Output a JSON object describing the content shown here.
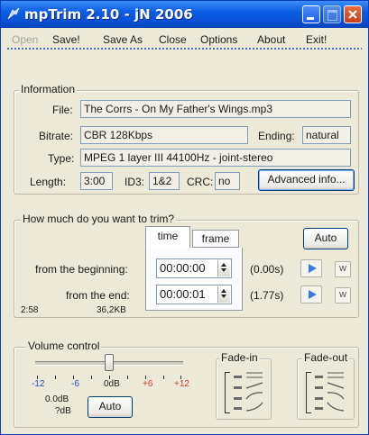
{
  "window": {
    "title": "mpTrim 2.10 - jN 2006"
  },
  "menu": {
    "items": [
      "Open",
      "Save!",
      "Save As",
      "Close",
      "Options",
      "About",
      "Exit!"
    ],
    "disabled": [
      "Open"
    ]
  },
  "information": {
    "group_title": "Information",
    "file_label": "File:",
    "file_value": "The Corrs - On My Father's Wings.mp3",
    "bitrate_label": "Bitrate:",
    "bitrate_value": "CBR 128Kbps",
    "ending_label": "Ending:",
    "ending_value": "natural",
    "type_label": "Type:",
    "type_value": "MPEG 1 layer III 44100Hz - joint-stereo",
    "length_label": "Length:",
    "length_value": "3:00",
    "id3_label": "ID3:",
    "id3_value": "1&2",
    "crc_label": "CRC:",
    "crc_value": "no",
    "advanced_button": "Advanced info..."
  },
  "trim": {
    "group_title": "How much do you want to trim?",
    "tab_time": "time",
    "tab_frame": "frame",
    "auto_button": "Auto",
    "beginning_label": "from the beginning:",
    "beginning_value": "00:00:00",
    "beginning_seconds": "(0.00s)",
    "end_label": "from the end:",
    "end_value": "00:00:01",
    "end_seconds": "(1.77s)",
    "w_label": "w",
    "duration": "2:58",
    "size": "36,2KB"
  },
  "volume": {
    "group_title": "Volume control",
    "scale": [
      "-12",
      "-6",
      "0dB",
      "+6",
      "+12"
    ],
    "level_fraction": 0.5,
    "gain_db": "0.0dB",
    "peak": "?dB",
    "auto_button": "Auto",
    "fade_in_label": "Fade-in",
    "fade_out_label": "Fade-out"
  },
  "colors": {
    "titlebar": "#0a5ee6",
    "accent": "#3a7ae0",
    "scale_red": "#d83a2a",
    "scale_blue": "#2a4fc8"
  }
}
